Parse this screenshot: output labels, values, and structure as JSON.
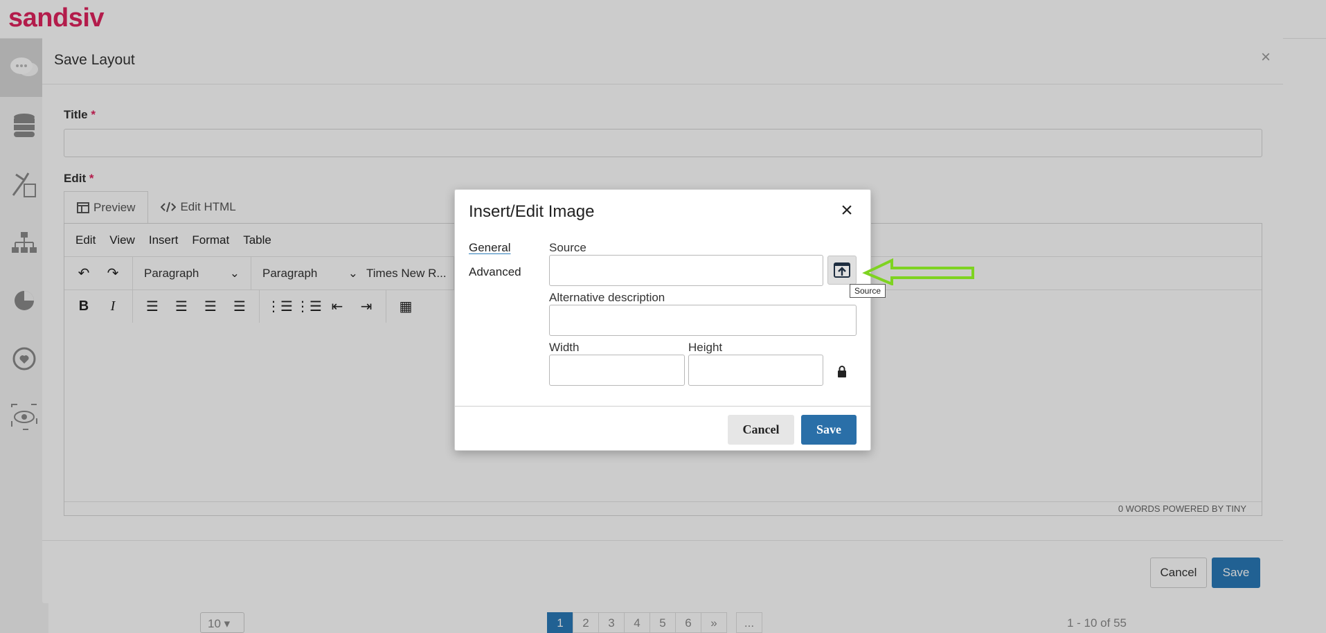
{
  "app": {
    "brand": "sandsiv",
    "brand_plus": "+",
    "topbar_icons": [
      "info-icon",
      "bell-icon",
      "user-icon"
    ],
    "sidebar_icons": [
      "chat-icon",
      "database-icon",
      "tools-icon",
      "hierarchy-icon",
      "pie-chart-icon",
      "feedback-icon",
      "eye-icon"
    ]
  },
  "background_pager": {
    "page_size": "10",
    "pages": [
      "1",
      "2",
      "3",
      "4",
      "5",
      "6",
      "»",
      "..."
    ],
    "current_page": "1",
    "range": "1 - 10 of 55"
  },
  "save_layout_modal": {
    "title": "Save Layout",
    "close": "×",
    "title_label": "Title",
    "title_value": "",
    "edit_label": "Edit",
    "required_mark": "*",
    "tabs": [
      {
        "label": "Preview",
        "icon": "preview-icon"
      },
      {
        "label": "Edit HTML",
        "icon": "code-icon"
      }
    ],
    "editor": {
      "menubar": [
        "Edit",
        "View",
        "Insert",
        "Format",
        "Table"
      ],
      "block_format_1": "Paragraph",
      "block_format_2": "Paragraph",
      "font_family": "Times New R...",
      "status": "0 WORDS  POWERED BY TINY"
    },
    "cancel_label": "Cancel",
    "save_label": "Save"
  },
  "image_dialog": {
    "title": "Insert/Edit Image",
    "close": "×",
    "tabs": [
      "General",
      "Advanced"
    ],
    "active_tab": "General",
    "source_label": "Source",
    "source_value": "",
    "alt_label": "Alternative description",
    "alt_value": "",
    "width_label": "Width",
    "width_value": "",
    "height_label": "Height",
    "height_value": "",
    "cancel_label": "Cancel",
    "save_label": "Save",
    "tooltip": "Source"
  },
  "colors": {
    "brand": "#e0245e",
    "primary": "#2a6fa8",
    "arrow": "#7ed321"
  }
}
